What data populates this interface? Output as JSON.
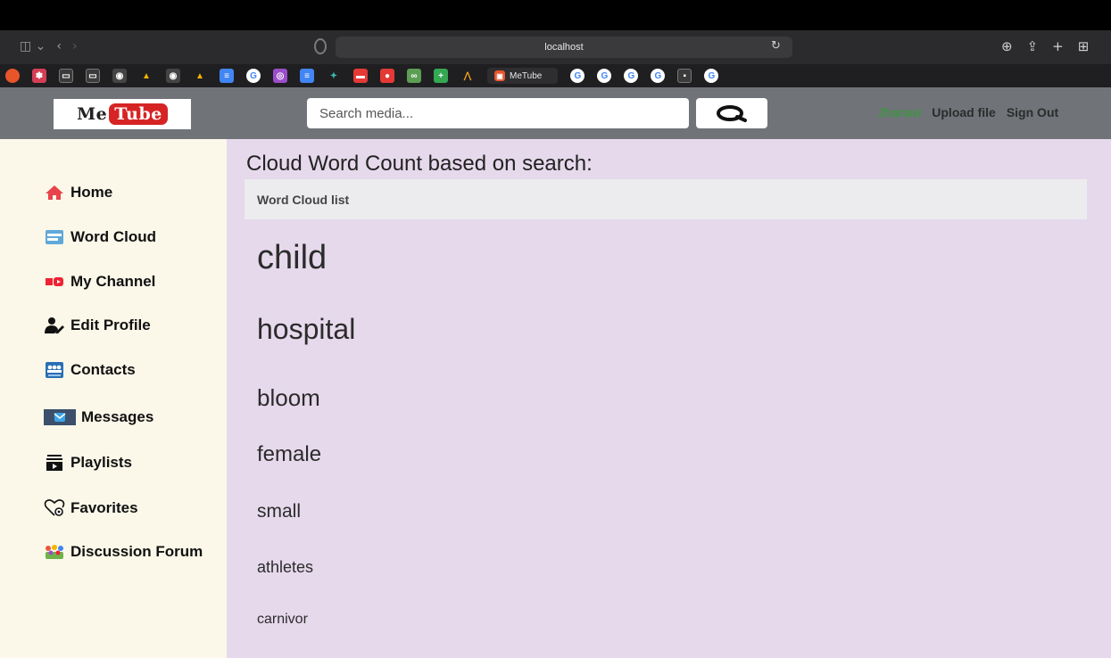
{
  "browser": {
    "url": "localhost",
    "active_tab_label": "MeTube"
  },
  "header": {
    "logo_left": "Me",
    "logo_right": "Tube",
    "search_placeholder": "Search media...",
    "user_name": "Jhanavi",
    "upload_label": "Upload file",
    "signout_label": "Sign Out"
  },
  "sidebar": {
    "items": [
      {
        "label": "Home",
        "icon": "home-icon"
      },
      {
        "label": "Word Cloud",
        "icon": "word-cloud-icon"
      },
      {
        "label": "My Channel",
        "icon": "youtube-icon"
      },
      {
        "label": "Edit Profile",
        "icon": "edit-profile-icon"
      },
      {
        "label": "Contacts",
        "icon": "contacts-icon"
      },
      {
        "label": "Messages",
        "icon": "messages-icon"
      },
      {
        "label": "Playlists",
        "icon": "playlist-icon"
      },
      {
        "label": "Favorites",
        "icon": "favorites-icon"
      },
      {
        "label": "Discussion Forum",
        "icon": "forum-icon"
      }
    ]
  },
  "main": {
    "title": "Cloud Word Count based on search:",
    "list_header": "Word Cloud list",
    "words": [
      "child",
      "hospital",
      "bloom",
      "female",
      "small",
      "athletes",
      "carnivor"
    ]
  },
  "colors": {
    "header_bg": "#707479",
    "sidebar_bg": "#fbf8e9",
    "main_bg": "#e6d9ec",
    "user_green": "#2f9e2f",
    "logo_red": "#d62424"
  }
}
